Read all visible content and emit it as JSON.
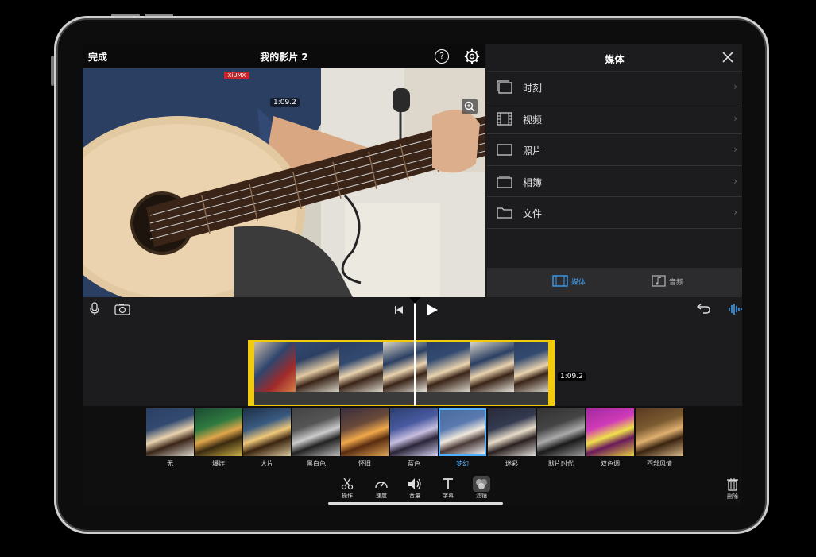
{
  "header": {
    "done_label": "完成",
    "title": "我的影片 2",
    "help_symbol": "?"
  },
  "preview": {
    "timecode": "1:09.2",
    "shirt_logo": "XiUMX"
  },
  "media": {
    "title": "媒体",
    "items": [
      {
        "label": "时刻",
        "icon": "moments-icon"
      },
      {
        "label": "视频",
        "icon": "film-icon"
      },
      {
        "label": "照片",
        "icon": "photo-icon"
      },
      {
        "label": "相簿",
        "icon": "album-icon"
      },
      {
        "label": "文件",
        "icon": "folder-icon"
      }
    ],
    "tabs": [
      {
        "label": "媒体",
        "active": true,
        "color": "#3a9bf0"
      },
      {
        "label": "音频",
        "active": false,
        "color": "#b5b5b5"
      }
    ]
  },
  "timeline": {
    "clip_duration": "1:09.2"
  },
  "filters": {
    "selected": "梦幻",
    "items": [
      {
        "label": "无"
      },
      {
        "label": "爆炸"
      },
      {
        "label": "大片"
      },
      {
        "label": "黑白色"
      },
      {
        "label": "怀旧"
      },
      {
        "label": "蓝色"
      },
      {
        "label": "梦幻"
      },
      {
        "label": "迷彩"
      },
      {
        "label": "默片时代"
      },
      {
        "label": "双色调"
      },
      {
        "label": "西部风情"
      }
    ]
  },
  "tools": [
    {
      "label": "操作",
      "icon": "scissors-icon"
    },
    {
      "label": "速度",
      "icon": "speedometer-icon"
    },
    {
      "label": "音量",
      "icon": "volume-icon"
    },
    {
      "label": "字幕",
      "icon": "text-icon"
    },
    {
      "label": "滤镜",
      "icon": "filter-icon"
    }
  ],
  "delete_label": "删除",
  "colors": {
    "accent": "#3a9bf0",
    "clip_border": "#f2cc0c",
    "active_filter": "#4fb1ff"
  }
}
